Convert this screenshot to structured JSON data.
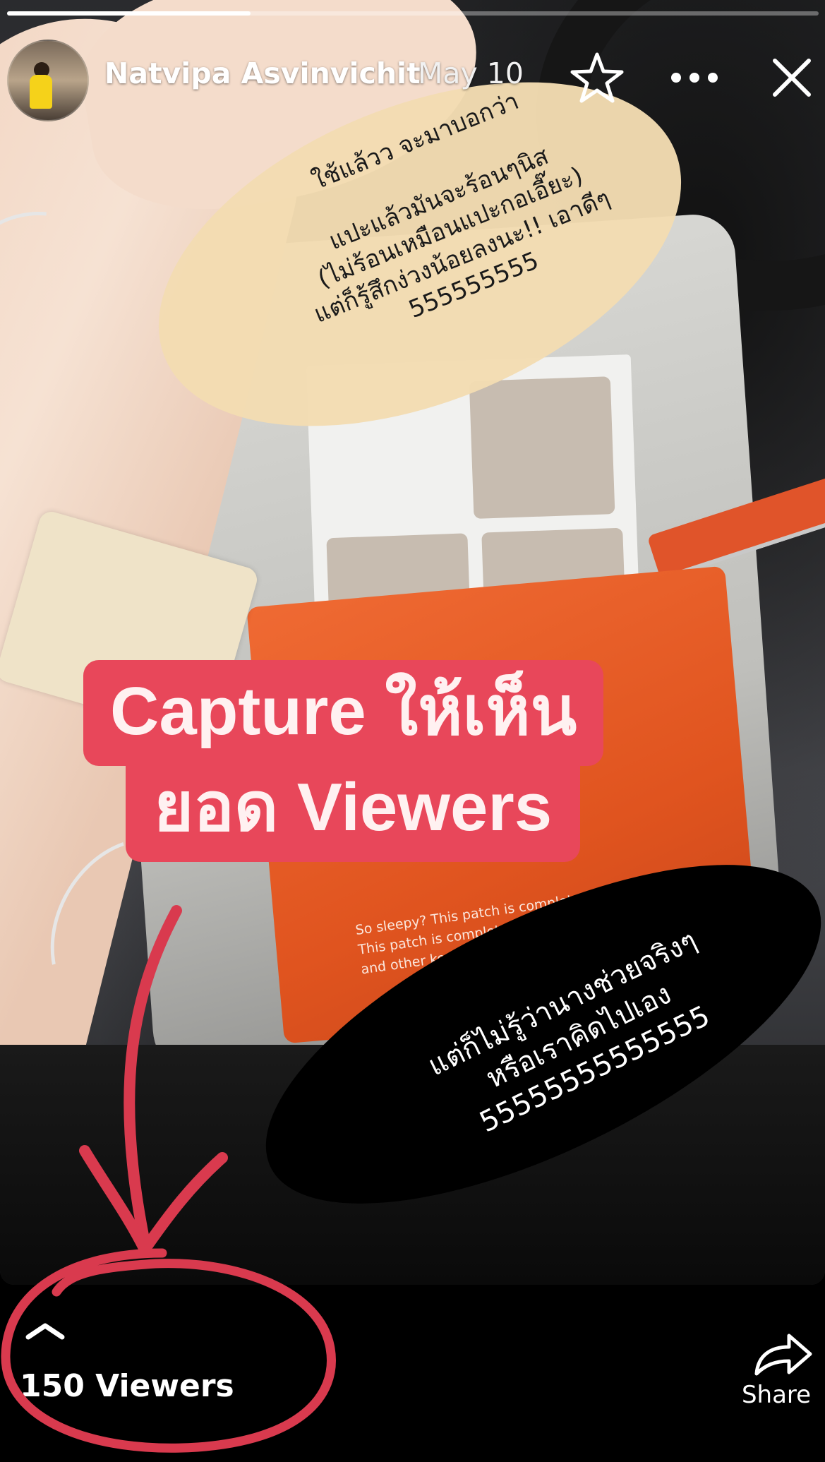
{
  "story": {
    "progress_fraction": 0.3,
    "user_name": "Natvipa Asvinvichit",
    "date": "May 10"
  },
  "stickers": {
    "beige_lines": [
      "ใช้แล้วว จะมาบอกว่า",
      "",
      "แปะแล้วมันจะร้อนๆนิส",
      "(ไม่ร้อนเหมือนแปะกอเอี๊ยะ)",
      "แต่ก็รู้สึกง่วงน้อยลงนะ!! เอาดีๆ",
      "555555555"
    ],
    "black_lines": [
      "แต่ก็ไม่รู้ว่านางช่วยจริงๆ",
      "หรือเราคิดไปเอง",
      "55555555555555"
    ],
    "pouch_text": "So sleepy? This patch is complete with B12, Ginseng\nThis patch is complete with B12, Caffeine\nand other key ingredients.  Give you a POWER BOOST!"
  },
  "caption": {
    "line1": "Capture ให้เห็น",
    "line2": "ยอด Viewers"
  },
  "bottom": {
    "viewers": "150 Viewers",
    "share_label": "Share"
  },
  "colors": {
    "caption_bg": "#e8475a",
    "annotation_red": "#d93a4e",
    "sticker_beige": "#f3dcb2"
  },
  "icons": [
    "star-icon",
    "more-icon",
    "close-icon",
    "chevron-up-icon",
    "share-icon"
  ]
}
